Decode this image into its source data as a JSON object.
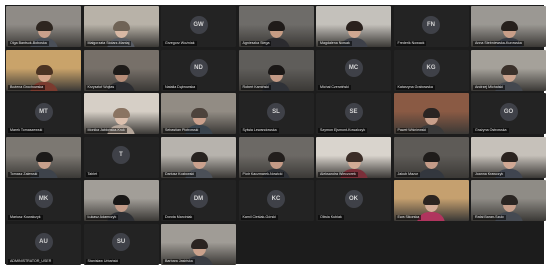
{
  "meeting": {
    "participants": [
      {
        "initials": "",
        "name": "Olga Bantsuk-Boboska",
        "video": true,
        "hair": "#2e2620",
        "skin": "#caa08b",
        "shirt": "#4a4f58",
        "bg": "#8f8b86"
      },
      {
        "initials": "",
        "name": "Małgorzata Stolarz-Mantaj",
        "video": true,
        "hair": "#6f6356",
        "skin": "#d8b8a4",
        "shirt": "#575b63",
        "bg": "#b8b2a8"
      },
      {
        "initials": "GW",
        "name": "Grzegorz Woźniak",
        "video": false
      },
      {
        "initials": "",
        "name": "Agnieszka Stega",
        "video": true,
        "hair": "#1f1b19",
        "skin": "#c69c84",
        "shirt": "#2b2b2f",
        "bg": "#6e6c69"
      },
      {
        "initials": "",
        "name": "Magdalena Nowak",
        "video": true,
        "hair": "#2a211d",
        "skin": "#d0a791",
        "shirt": "#3d4049",
        "bg": "#c4c1bb"
      },
      {
        "initials": "FN",
        "name": "Frederik Nowack",
        "video": false
      },
      {
        "initials": "",
        "name": "Anna Stebniewska-Kurowska",
        "video": true,
        "hair": "#26201c",
        "skin": "#c89e88",
        "shirt": "#353942",
        "bg": "#9b9893"
      },
      {
        "initials": "",
        "name": "Bożena Grochowska",
        "video": true,
        "hair": "#4b3323",
        "skin": "#d5a58a",
        "shirt": "#7b3b2f",
        "bg": "#c9a36a"
      },
      {
        "initials": "",
        "name": "Krzysztof Wojtas",
        "video": true,
        "hair": "#1e1b19",
        "skin": "#b78d78",
        "shirt": "#2c2d31",
        "bg": "#777069"
      },
      {
        "initials": "ND",
        "name": "Natalia Dąbrowska",
        "video": false
      },
      {
        "initials": "",
        "name": "Robert Kamiński",
        "video": true,
        "hair": "#1a1716",
        "skin": "#c29985",
        "shirt": "#2f3238",
        "bg": "#5f5d5a"
      },
      {
        "initials": "MC",
        "name": "Michał Czerwiński",
        "video": false
      },
      {
        "initials": "KG",
        "name": "Katarzyna Grabowska",
        "video": false
      },
      {
        "initials": "",
        "name": "Andrzej Michalski",
        "video": true,
        "hair": "#3a302a",
        "skin": "#cba38e",
        "shirt": "#44484f",
        "bg": "#a5a19a"
      },
      {
        "initials": "MT",
        "name": "Marek Tomaszewski",
        "video": false
      },
      {
        "initials": "",
        "name": "Monika Jabłońska-Kruk",
        "video": true,
        "hair": "#8a7462",
        "skin": "#dcc0ae",
        "shirt": "#b5a69a",
        "bg": "#d6cfc6"
      },
      {
        "initials": "",
        "name": "Sebastian Piotrowski",
        "video": true,
        "hair": "#4d433c",
        "skin": "#caa08c",
        "shirt": "#39444e",
        "bg": "#928c84"
      },
      {
        "initials": "SL",
        "name": "Sylwia Lewandowska",
        "video": false
      },
      {
        "initials": "SE",
        "name": "Szymon Ejsmont-Kowalczyk",
        "video": false
      },
      {
        "initials": "",
        "name": "Paweł Wiśniewski",
        "video": true,
        "hair": "#2a2422",
        "skin": "#c9a08b",
        "shirt": "#3a3a3a",
        "bg": "#8a5a44"
      },
      {
        "initials": "GO",
        "name": "Grażyna Ostrowska",
        "video": false
      },
      {
        "initials": "",
        "name": "Tomasz Zalewski",
        "video": true,
        "hair": "#1c1a19",
        "skin": "#c7a08c",
        "shirt": "#3e434b",
        "bg": "#7c7872"
      },
      {
        "initials": "T",
        "name": "Tablet",
        "video": false
      },
      {
        "initials": "",
        "name": "Dariusz Kozłowski",
        "video": true,
        "hair": "#27221f",
        "skin": "#caa18d",
        "shirt": "#4b5058",
        "bg": "#b7b3ad"
      },
      {
        "initials": "",
        "name": "Piotr Kaczmarek-Nowicki",
        "video": true,
        "hair": "#221e1c",
        "skin": "#c49a86",
        "shirt": "#2d3036",
        "bg": "#6c6965"
      },
      {
        "initials": "",
        "name": "Aleksandra Wieczorek",
        "video": true,
        "hair": "#3b2d27",
        "skin": "#d1aa95",
        "shirt": "#7a2f39",
        "bg": "#d9d4cd"
      },
      {
        "initials": "",
        "name": "Jakub Mazur",
        "video": true,
        "hair": "#1f1c1a",
        "skin": "#c59c88",
        "shirt": "#33373e",
        "bg": "#5e5b57"
      },
      {
        "initials": "",
        "name": "Joanna Krawczyk",
        "video": true,
        "hair": "#2a231f",
        "skin": "#d0a894",
        "shirt": "#404550",
        "bg": "#c6c1ba"
      },
      {
        "initials": "MK",
        "name": "Mariusz Kowalczyk",
        "video": false
      },
      {
        "initials": "",
        "name": "Łukasz Adamczyk",
        "video": true,
        "hair": "#191716",
        "skin": "#c29a87",
        "shirt": "#2e3035",
        "bg": "#a29e98"
      },
      {
        "initials": "DM",
        "name": "Dorota Marciniak",
        "video": false
      },
      {
        "initials": "KC",
        "name": "Kamil Cieślak-Górski",
        "video": false
      },
      {
        "initials": "OK",
        "name": "Oliwia Kubiak",
        "video": false
      },
      {
        "initials": "",
        "name": "Ewa Sikorska",
        "video": true,
        "hair": "#2c2420",
        "skin": "#d4ad98",
        "shirt": "#b0355e",
        "bg": "#c5a06f"
      },
      {
        "initials": "",
        "name": "Rafał Baran-Szulc",
        "video": true,
        "hair": "#2a2522",
        "skin": "#c79f8b",
        "shirt": "#454a52",
        "bg": "#8f8c86"
      },
      {
        "initials": "AU",
        "name": "ADMINISTRATOR_USER",
        "video": false
      },
      {
        "initials": "SU",
        "name": "Stanisław Urbański",
        "video": false
      },
      {
        "initials": "",
        "name": "Barbara Jasińska",
        "video": true,
        "hair": "#2a2320",
        "skin": "#caa18c",
        "shirt": "#3a3d44",
        "bg": "#a09c96"
      }
    ]
  }
}
